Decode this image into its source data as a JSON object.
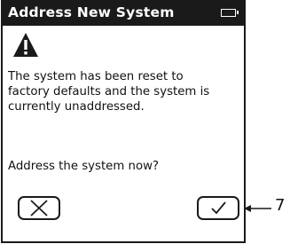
{
  "window": {
    "title": "Address New System",
    "status_icon": "battery-icon"
  },
  "dialog": {
    "icon": "warning-icon",
    "message_lines": [
      "The system has been reset to",
      "factory defaults and the system is",
      "currently unaddressed."
    ],
    "question": "Address the system now?"
  },
  "buttons": {
    "cancel_icon": "x-icon",
    "confirm_icon": "checkmark-icon"
  },
  "annotation": {
    "callout_number": "7"
  }
}
